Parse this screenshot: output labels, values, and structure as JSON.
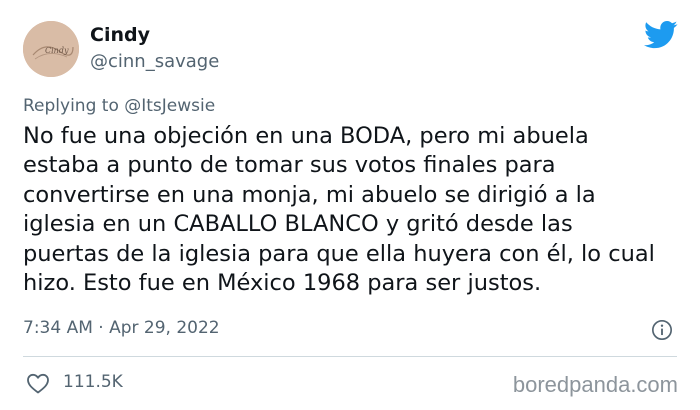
{
  "author": {
    "display_name": "Cindy",
    "handle": "@cinn_savage",
    "avatar_text": "Cindy"
  },
  "reply_context": {
    "prefix": "Replying to",
    "mention": "@ItsJewsie"
  },
  "tweet": {
    "text": "No fue una objeción en una BODA, pero mi abuela estaba a punto de tomar sus votos finales para convertirse en una monja, mi abuelo se dirigió a la iglesia en un CABALLO BLANCO y gritó desde las puertas de la iglesia para que ella huyera con él, lo cual hizo. Esto fue en México 1968 para ser justos.",
    "timestamp": "7:34 AM · Apr 29, 2022"
  },
  "stats": {
    "likes": "111.5K"
  },
  "watermark": "boredpanda.com",
  "colors": {
    "twitter_blue": "#1d9bf0",
    "secondary_text": "#536471",
    "primary_text": "#0f1419"
  }
}
